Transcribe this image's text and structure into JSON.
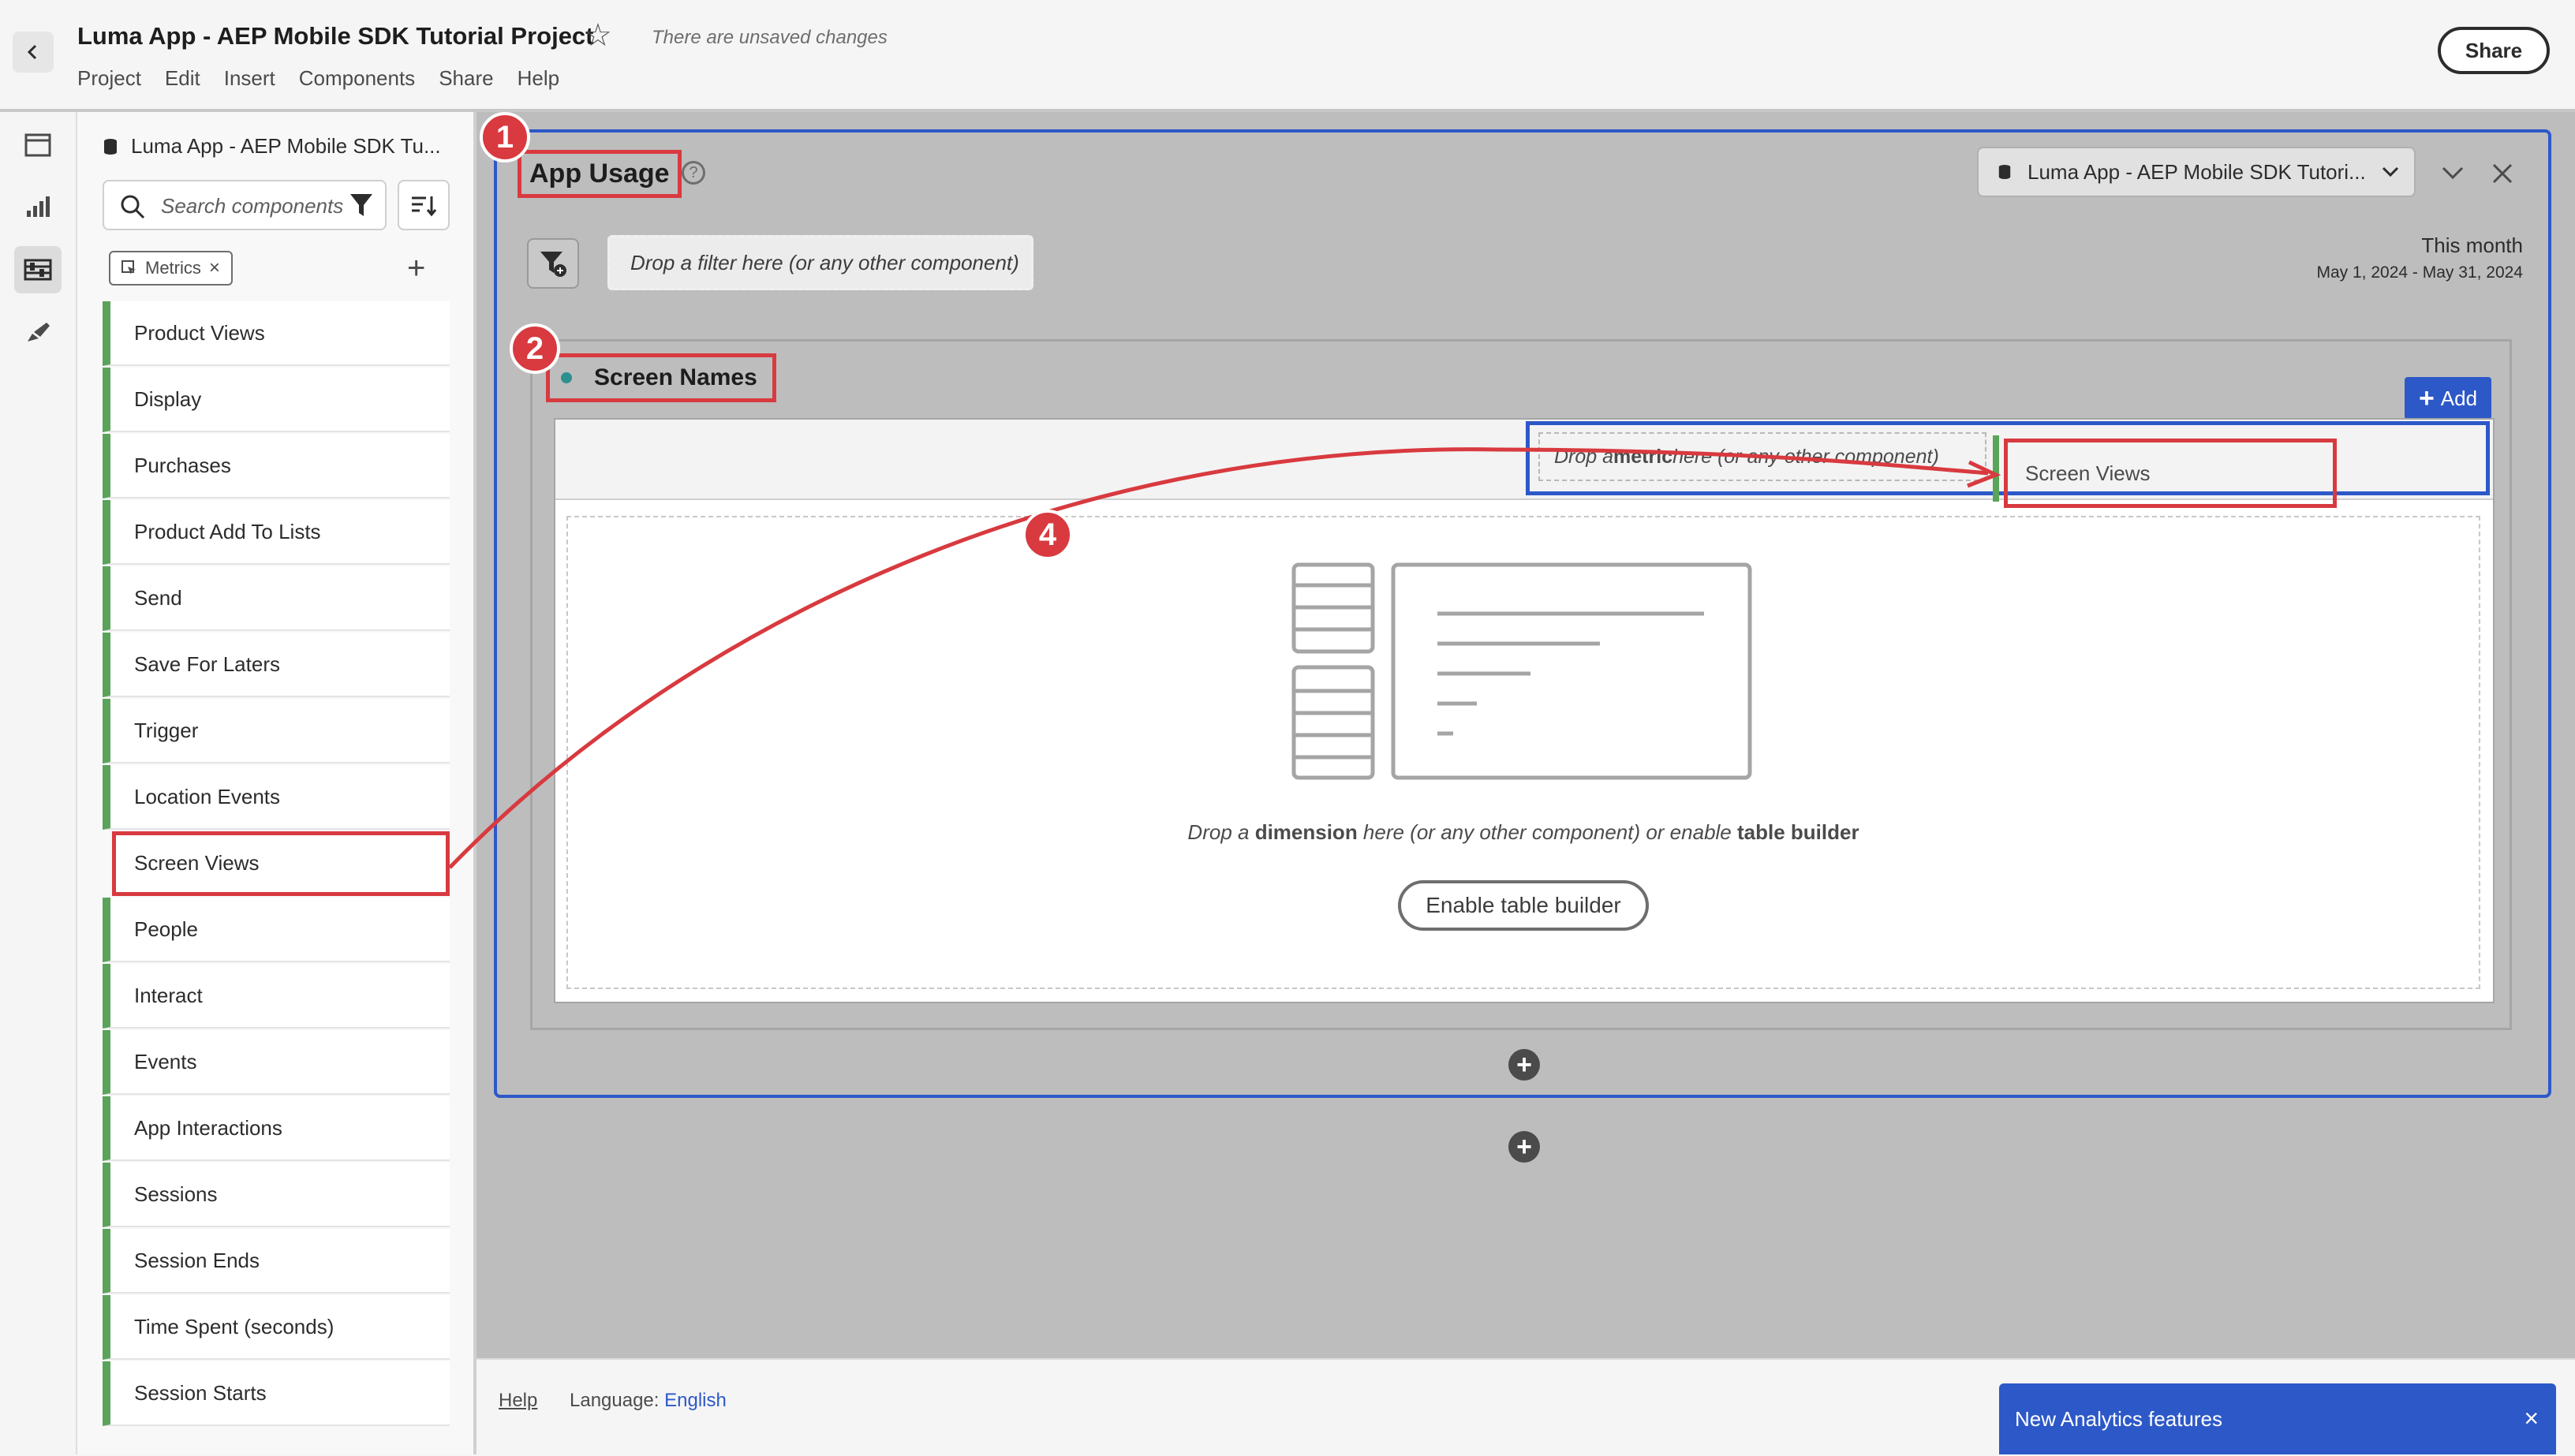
{
  "header": {
    "title": "Luma App - AEP Mobile SDK Tutorial Project",
    "unsaved": "There are unsaved changes",
    "menu": [
      "Project",
      "Edit",
      "Insert",
      "Components",
      "Share",
      "Help"
    ],
    "share_label": "Share"
  },
  "panel": {
    "data_source": "Luma App - AEP Mobile SDK Tu...",
    "search_placeholder": "Search components",
    "tag_label": "Metrics",
    "items": [
      "Product Views",
      "Display",
      "Purchases",
      "Product Add To Lists",
      "Send",
      "Save For Laters",
      "Trigger",
      "Location Events",
      "Screen Views",
      "People",
      "Interact",
      "Events",
      "App Interactions",
      "Sessions",
      "Session Ends",
      "Time Spent (seconds)",
      "Session Starts"
    ],
    "selected_item": "Screen Views"
  },
  "main": {
    "panel_title": "App Usage",
    "data_source_select": "Luma App - AEP Mobile SDK Tutori...",
    "filter_drop": "Drop a filter here (or any other component)",
    "date_title": "This month",
    "date_range": "May 1, 2024 - May 31, 2024",
    "viz_title": "Screen Names",
    "add_label": "Add",
    "metric_drop_prefix": "Drop a ",
    "metric_drop_bold": "metric",
    "metric_drop_suffix": " here (or any other component)",
    "dropped_metric": "Screen Views",
    "dim_prefix": "Drop a ",
    "dim_bold": "dimension",
    "dim_mid": " here (or any other component) or enable ",
    "dim_bold2": "table builder",
    "enable_label": "Enable table builder"
  },
  "badges": [
    "1",
    "2",
    "4"
  ],
  "footer": {
    "help": "Help",
    "language_label": "Language: ",
    "language_value": "English",
    "toast": "New Analytics features"
  },
  "colors": {
    "accent_blue": "#2d58c8",
    "annotation_red": "#d83a3f",
    "metric_green": "#5aa35a"
  }
}
